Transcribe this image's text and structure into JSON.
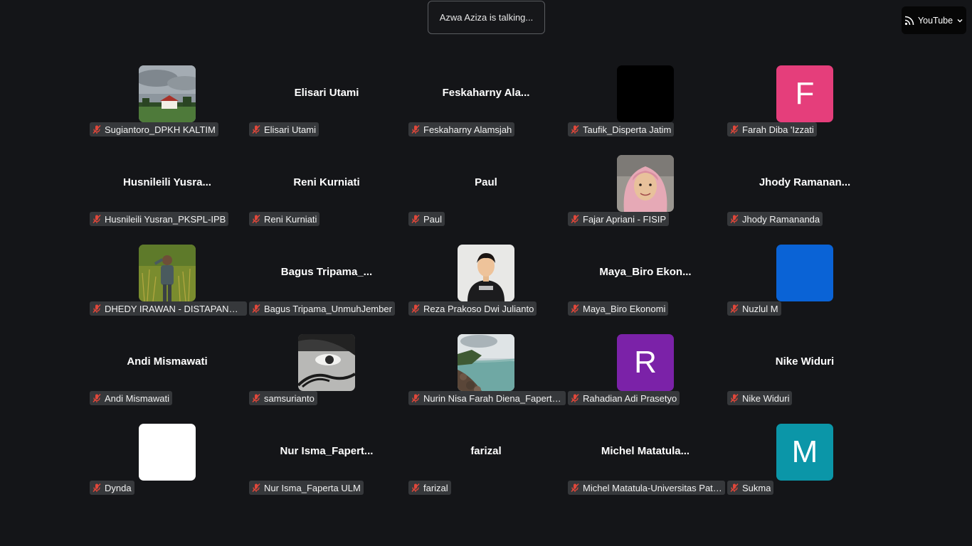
{
  "talking_indicator": "Azwa Aziza is talking...",
  "livestream": {
    "label": "YouTube",
    "icon": "rss-broadcast-icon"
  },
  "colors": {
    "background": "#141518",
    "mic_muted": "#e0473a",
    "avatar_farah": "#e53e7b",
    "avatar_rahadian": "#7b22a8",
    "avatar_sukma": "#0b96a8",
    "avatar_nuzlul": "#0a63d6"
  },
  "participants": [
    {
      "label": "Sugiantoro_DPKH KALTIM",
      "avatar": "photo-building"
    },
    {
      "label": "Elisari Utami",
      "tile_name": "Elisari Utami"
    },
    {
      "label": "Feskaharny Alamsjah",
      "tile_name": "Feskaharny  Ala..."
    },
    {
      "label": "Taufik_Disperta Jatim",
      "avatar": "photo-black"
    },
    {
      "label": "Farah Diba 'Izzati",
      "letter": "F"
    },
    {
      "label": "Husnileili Yusran_PKSPL-IPB",
      "tile_name": "Husnileili  Yusra..."
    },
    {
      "label": "Reni Kurniati",
      "tile_name": "Reni Kurniati"
    },
    {
      "label": "Paul",
      "tile_name": "Paul"
    },
    {
      "label": "Fajar Apriani - FISIP",
      "avatar": "photo-hijab"
    },
    {
      "label": "Jhody Ramananda",
      "tile_name": "Jhody  Ramanan..."
    },
    {
      "label": "DHEDY IRAWAN - DISTAPANGTA...",
      "avatar": "photo-field"
    },
    {
      "label": "Bagus Tripama_UnmuhJember",
      "tile_name": "Bagus  Tripama_..."
    },
    {
      "label": "Reza Prakoso Dwi Julianto",
      "avatar": "photo-man"
    },
    {
      "label": "Maya_Biro Ekonomi",
      "tile_name": "Maya_Biro  Ekon..."
    },
    {
      "label": "Nuzlul M",
      "avatar": "solid-blue"
    },
    {
      "label": "Andi Mismawati",
      "tile_name": "Andi Mismawati"
    },
    {
      "label": "samsurianto",
      "avatar": "photo-eye"
    },
    {
      "label": "Nurin Nisa Farah Diena_Faperta ...",
      "avatar": "photo-coast"
    },
    {
      "label": "Rahadian Adi Prasetyo",
      "letter": "R"
    },
    {
      "label": "Nike Widuri",
      "tile_name": "Nike Widuri"
    },
    {
      "label": "Dynda",
      "avatar": "solid-white"
    },
    {
      "label": "Nur Isma_Faperta ULM",
      "tile_name": "Nur  Isma_Fapert..."
    },
    {
      "label": "farizal",
      "tile_name": "farizal"
    },
    {
      "label": "Michel Matatula-Universitas Patti...",
      "tile_name": "Michel  Matatula..."
    },
    {
      "label": "Sukma",
      "letter": "M"
    }
  ]
}
